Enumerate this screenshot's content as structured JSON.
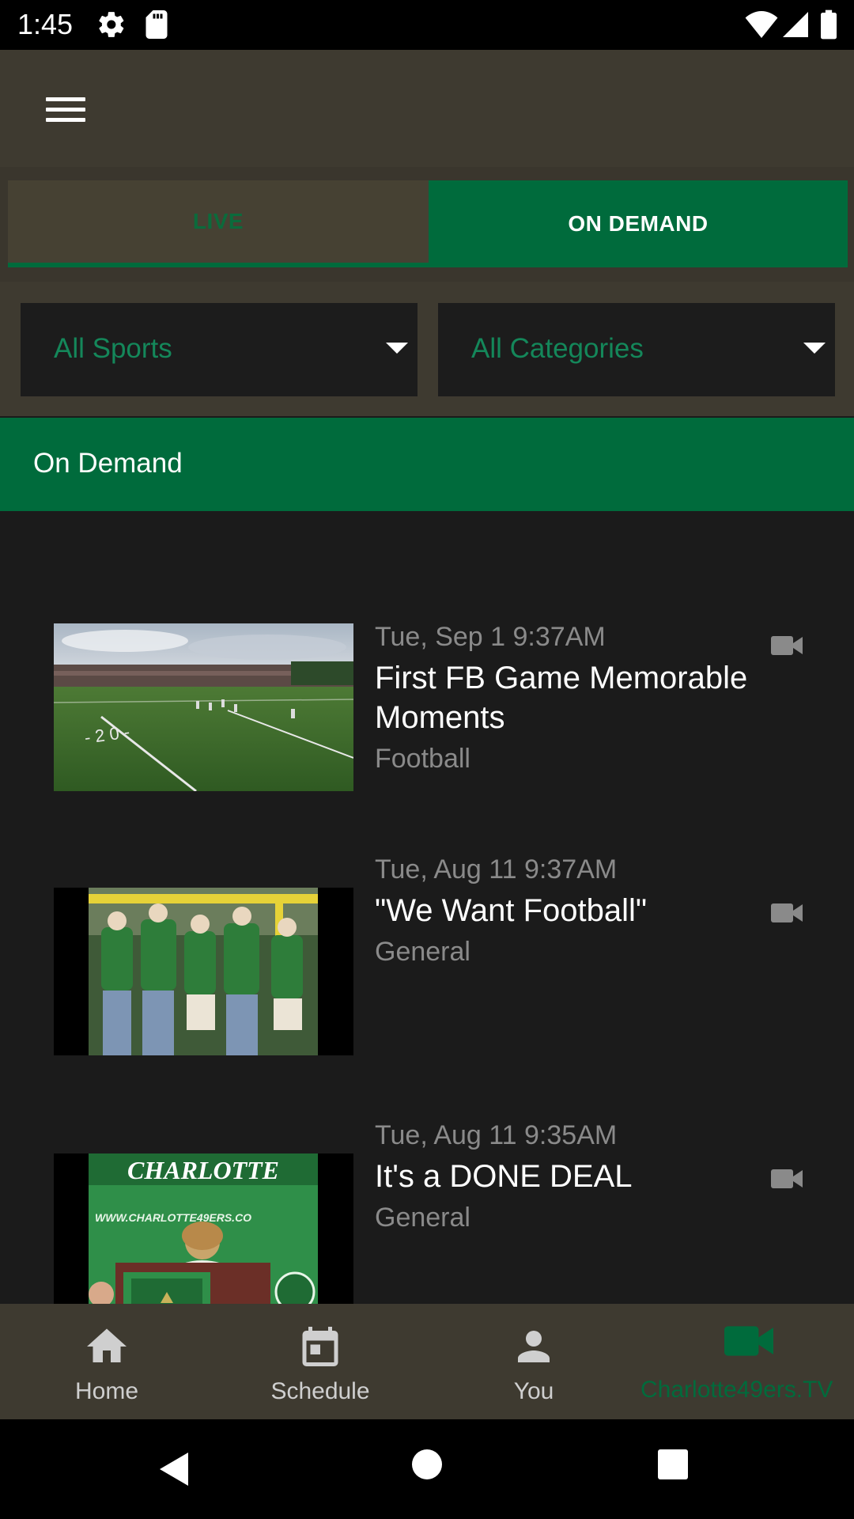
{
  "status_bar": {
    "time": "1:45",
    "icons": [
      "gear-icon",
      "sd-card-icon",
      "wifi-icon",
      "signal-icon",
      "battery-icon"
    ]
  },
  "app_bar": {
    "menu_icon": "hamburger-menu-icon"
  },
  "tabs": [
    {
      "label": "LIVE",
      "selected": false
    },
    {
      "label": "ON DEMAND",
      "selected": true
    }
  ],
  "filters": {
    "sports": {
      "value": "All Sports"
    },
    "categories": {
      "value": "All Categories"
    }
  },
  "section": {
    "title": "On Demand"
  },
  "items": [
    {
      "date": "Tue, Sep 1 9:37AM",
      "title": "First FB Game Memorable Moments",
      "category": "Football",
      "thumbnail": "football field with crowd",
      "icon": "video-camera-icon"
    },
    {
      "date": "Tue, Aug 11 9:37AM",
      "title": "\"We Want Football\"",
      "category": "General",
      "thumbnail": "fans in green shirts under goal post",
      "icon": "video-camera-icon"
    },
    {
      "date": "Tue, Aug 11 9:35AM",
      "title": "It's a DONE DEAL",
      "category": "General",
      "thumbnail": "speaker at podium with Charlotte banner",
      "icon": "video-camera-icon"
    }
  ],
  "thumbnail_text": {
    "banner": "CHARLOTTE",
    "url": "WWW.CHARLOTTE49ERS.CO"
  },
  "bottom_nav": [
    {
      "label": "Home",
      "icon": "home-icon",
      "active": false
    },
    {
      "label": "Schedule",
      "icon": "calendar-icon",
      "active": false
    },
    {
      "label": "You",
      "icon": "person-icon",
      "active": false
    },
    {
      "label": "Charlotte49ers.TV",
      "icon": "video-camera-icon",
      "active": true
    }
  ],
  "colors": {
    "brand_green": "#006b3c",
    "app_bar": "#3e3a30",
    "background": "#1b1b1b",
    "muted_text": "#8a8a8a"
  }
}
